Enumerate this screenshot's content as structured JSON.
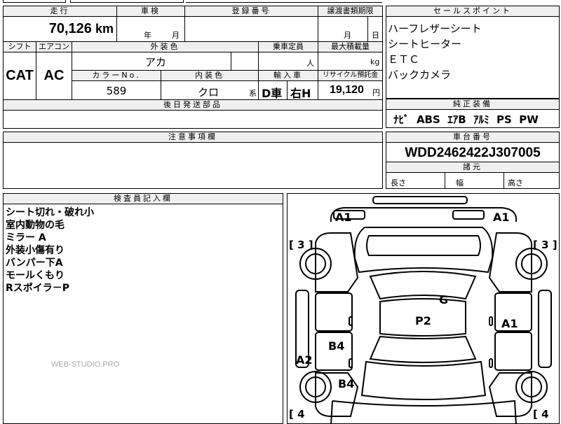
{
  "top": {
    "mileage_header": "走行",
    "mileage_value": "70,126",
    "mileage_unit": "km",
    "inspection_header": "車検",
    "inspection_year": "年",
    "inspection_month": "月",
    "registration_header": "登録番号",
    "transfer_header": "譲渡書類期限",
    "transfer_month": "月",
    "transfer_day": "日"
  },
  "mid": {
    "shift_header": "シフト",
    "shift_value": "CAT",
    "ac_header": "エアコン",
    "ac_value": "AC",
    "ext_color_header": "外装色",
    "ext_color_value": "アカ",
    "capacity_header": "乗車定員",
    "capacity_unit": "人",
    "load_header": "最大積載量",
    "load_unit": "kg",
    "color_no_header": "カラーNo.",
    "color_no_value": "589",
    "int_color_header": "内装色",
    "int_color_value": "クロ",
    "int_color_suffix": "系",
    "import_header": "輸入車",
    "import_dealer": "D車",
    "import_handle": "右H",
    "recycle_header": "リサイクル預託金",
    "recycle_value": "19,120",
    "recycle_unit": "円",
    "later_parts_header": "後日発送部品"
  },
  "sales": {
    "header": "セールスポイント",
    "items": [
      "ハーフレザーシート",
      "シートヒーター",
      "ＥＴＣ",
      "バックカメラ"
    ]
  },
  "equipment": {
    "header": "純正装備",
    "value": "ﾅﾋﾞ  ABS  ｴｱB  ｱﾙﾐ  PS  PW"
  },
  "notes": {
    "header": "注意事項欄"
  },
  "chassis": {
    "header": "車台番号",
    "value": "WDD2462422J307005"
  },
  "dimensions": {
    "header": "諸元",
    "length": "長さ",
    "width": "幅",
    "height": "高さ"
  },
  "inspector": {
    "header": "検査員記入欄",
    "lines": [
      "シート切れ・破れ小",
      "室内動物の毛",
      "ミラー A",
      "外装小傷有り",
      "バンパー下A",
      "モールくもり",
      "Rスポイラ－P"
    ]
  },
  "watermark": "WEB-STUDIO.PRO",
  "diagram": {
    "labels": {
      "front_left": "A1",
      "front_right": "A1",
      "left_fender": "[ 3 ]",
      "right_fender": "[ 3 ]",
      "roof": "G",
      "center": "P2",
      "right_door": "A1",
      "left_rear_door": "B4",
      "left_quarter": "A2",
      "left_rear": "B4",
      "rear_left": "[ 4",
      "rear_right": "[ 4"
    }
  }
}
